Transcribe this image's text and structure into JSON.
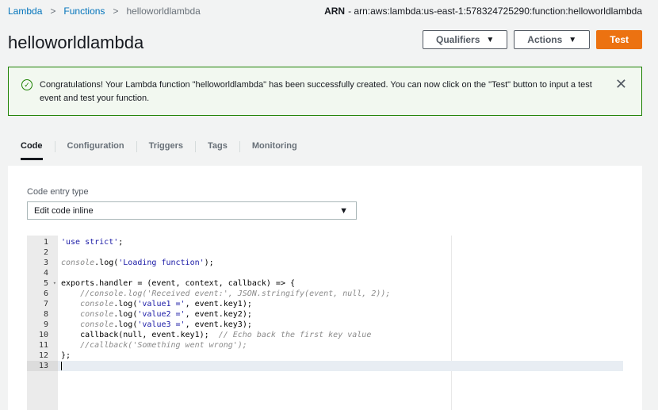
{
  "breadcrumb": {
    "items": [
      "Lambda",
      "Functions",
      "helloworldlambda"
    ],
    "separator": ">"
  },
  "arn": {
    "label": "ARN",
    "value": "- arn:aws:lambda:us-east-1:578324725290:function:helloworldlambda"
  },
  "page_title": "helloworldlambda",
  "header_actions": {
    "qualifiers_label": "Qualifiers",
    "actions_label": "Actions",
    "test_label": "Test",
    "caret": "▼"
  },
  "flash": {
    "message": "Congratulations! Your Lambda function \"helloworldlambda\" has been successfully created. You can now click on the \"Test\" button to input a test event and test your function.",
    "close_glyph": "✕",
    "icon": "check-circle-icon",
    "color": "#1d8102"
  },
  "tabs": [
    "Code",
    "Configuration",
    "Triggers",
    "Tags",
    "Monitoring"
  ],
  "active_tab": "Code",
  "code_entry": {
    "label": "Code entry type",
    "selected": "Edit code inline",
    "caret": "▼"
  },
  "editor": {
    "lines": [
      {
        "n": "1",
        "text": "'use strict';"
      },
      {
        "n": "2",
        "text": ""
      },
      {
        "n": "3",
        "text": "console.log('Loading function');"
      },
      {
        "n": "4",
        "text": ""
      },
      {
        "n": "5",
        "text": "exports.handler = (event, context, callback) => {"
      },
      {
        "n": "6",
        "text": "    //console.log('Received event:', JSON.stringify(event, null, 2));"
      },
      {
        "n": "7",
        "text": "    console.log('value1 =', event.key1);"
      },
      {
        "n": "8",
        "text": "    console.log('value2 =', event.key2);"
      },
      {
        "n": "9",
        "text": "    console.log('value3 =', event.key3);"
      },
      {
        "n": "10",
        "text": "    callback(null, event.key1);  // Echo back the first key value"
      },
      {
        "n": "11",
        "text": "    //callback('Something went wrong');"
      },
      {
        "n": "12",
        "text": "};"
      },
      {
        "n": "13",
        "text": ""
      }
    ],
    "active_line": "13"
  },
  "colors": {
    "accent_orange": "#ec7211",
    "link_blue": "#0073bb",
    "success_green": "#1d8102"
  }
}
